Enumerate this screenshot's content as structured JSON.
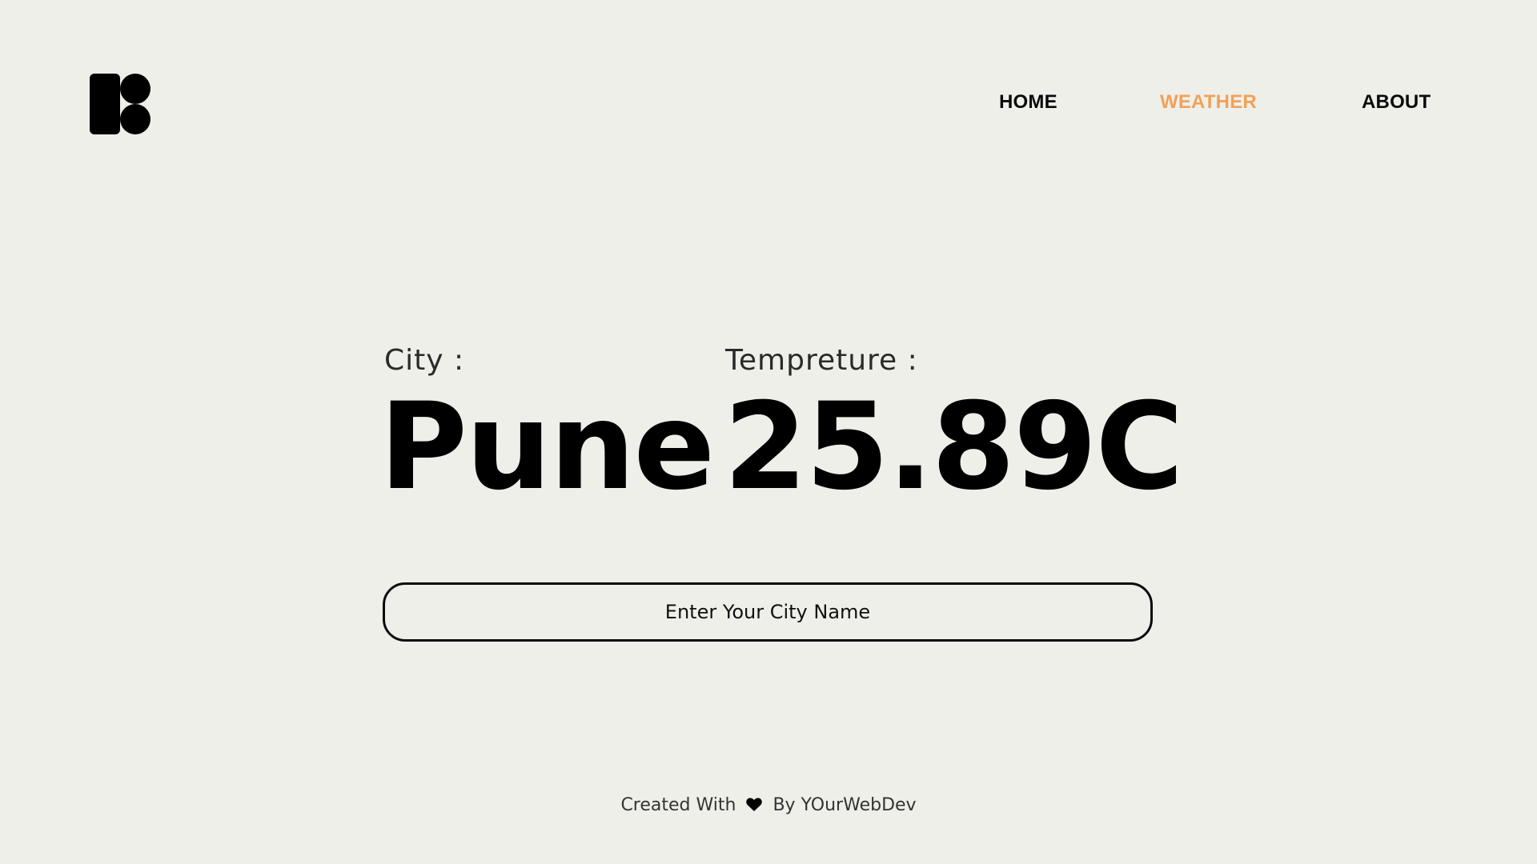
{
  "brand": {
    "logo_icon": "brand-logo-icon"
  },
  "nav": {
    "items": [
      {
        "label": "HOME"
      },
      {
        "label": "WEATHER",
        "active": true
      },
      {
        "label": "ABOUT"
      }
    ],
    "active_color": "#f0a258"
  },
  "weather": {
    "city_label": "City :",
    "city_value": "Pune",
    "temperature_label": "Tempreture :",
    "temperature_value": "25.89C"
  },
  "search": {
    "placeholder": "Enter Your City Name",
    "value": ""
  },
  "footer": {
    "created_with": "Created With",
    "heart_icon": "heart-icon",
    "by_text": "By YOurWebDev"
  },
  "colors": {
    "background": "#efefea",
    "text": "#000000",
    "accent": "#f0a258"
  }
}
